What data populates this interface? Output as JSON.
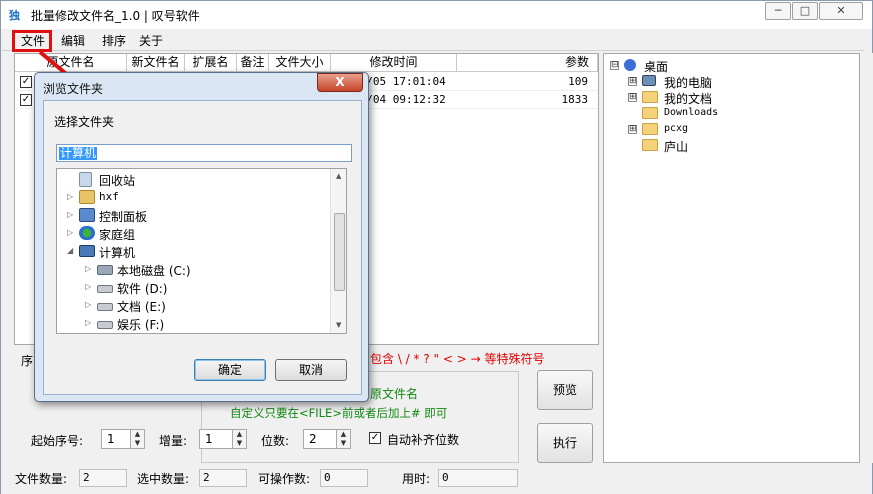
{
  "window": {
    "title": "批量修改文件名_1.0 | 叹号软件",
    "icon_text": "独",
    "controls": [
      "─",
      "□",
      "✕"
    ]
  },
  "menu": [
    "文件",
    "编辑",
    "排序",
    "关于"
  ],
  "list": {
    "headers": [
      "原文件名",
      "新文件名",
      "扩展名",
      "备注",
      "文件大小",
      "修改时间",
      "参数"
    ],
    "rows": [
      {
        "checked": "✓",
        "modified": "05/05 17:01:04",
        "param": "109"
      },
      {
        "checked": "✓",
        "modified": "06/04 09:12:32",
        "param": "1833"
      }
    ]
  },
  "tree": {
    "items": [
      {
        "label": "桌面",
        "expander": "⊟",
        "icon": "monitor-user-icon"
      },
      {
        "label": "我的电脑",
        "expander": "⊞",
        "icon": "computer-icon"
      },
      {
        "label": "我的文档",
        "expander": "⊞",
        "icon": "folder-icon"
      },
      {
        "label": "Downloads",
        "expander": "",
        "icon": "folder-icon"
      },
      {
        "label": "pcxg",
        "expander": "⊞",
        "icon": "folder-icon"
      },
      {
        "label": "庐山",
        "expander": "",
        "icon": "folder-icon"
      }
    ]
  },
  "options": {
    "seq_prefix": "序",
    "forbidden_hint": "包含 \\ /  * ? \" < > → 等特殊符号",
    "orig_name_hint": "原文件名",
    "custom_hint": "自定义只要在<FILE>前或者后加上# 即可",
    "start_label": "起始序号:",
    "start_value": "1",
    "incr_label": "增量:",
    "incr_value": "1",
    "digits_label": "位数:",
    "digits_value": "2",
    "auto_pad_label": "自动补齐位数",
    "auto_pad_checked": "✓",
    "preview_label": "预览",
    "run_label": "执行"
  },
  "status": {
    "count_label": "文件数量:",
    "count_value": "2",
    "selected_label": "选中数量:",
    "selected_value": "2",
    "operable_label": "可操作数:",
    "operable_value": "0",
    "time_label": "用时:",
    "time_value": "0"
  },
  "dialog": {
    "title": "浏览文件夹",
    "close": "X",
    "prompt": "选择文件夹",
    "path_value": "计算机",
    "items": [
      {
        "label": "回收站",
        "indent": 0,
        "tri": "",
        "icon": "recycle-bin-icon"
      },
      {
        "label": "hxf",
        "indent": 0,
        "tri": "▷",
        "icon": "user-folder-icon"
      },
      {
        "label": "控制面板",
        "indent": 0,
        "tri": "▷",
        "icon": "control-panel-icon"
      },
      {
        "label": "家庭组",
        "indent": 0,
        "tri": "▷",
        "icon": "homegroup-icon"
      },
      {
        "label": "计算机",
        "indent": 0,
        "tri": "◢",
        "icon": "computer-icon"
      },
      {
        "label": "本地磁盘 (C:)",
        "indent": 1,
        "tri": "▷",
        "icon": "system-drive-icon"
      },
      {
        "label": "软件 (D:)",
        "indent": 1,
        "tri": "▷",
        "icon": "drive-icon"
      },
      {
        "label": "文档 (E:)",
        "indent": 1,
        "tri": "▷",
        "icon": "drive-icon"
      },
      {
        "label": "娱乐 (F:)",
        "indent": 1,
        "tri": "▷",
        "icon": "drive-icon"
      }
    ],
    "ok_label": "确定",
    "cancel_label": "取消"
  },
  "colors": {
    "highlight_red": "#e01010",
    "hint_red": "#e00000",
    "hint_green": "#118811",
    "selection_blue": "#3399ff"
  }
}
